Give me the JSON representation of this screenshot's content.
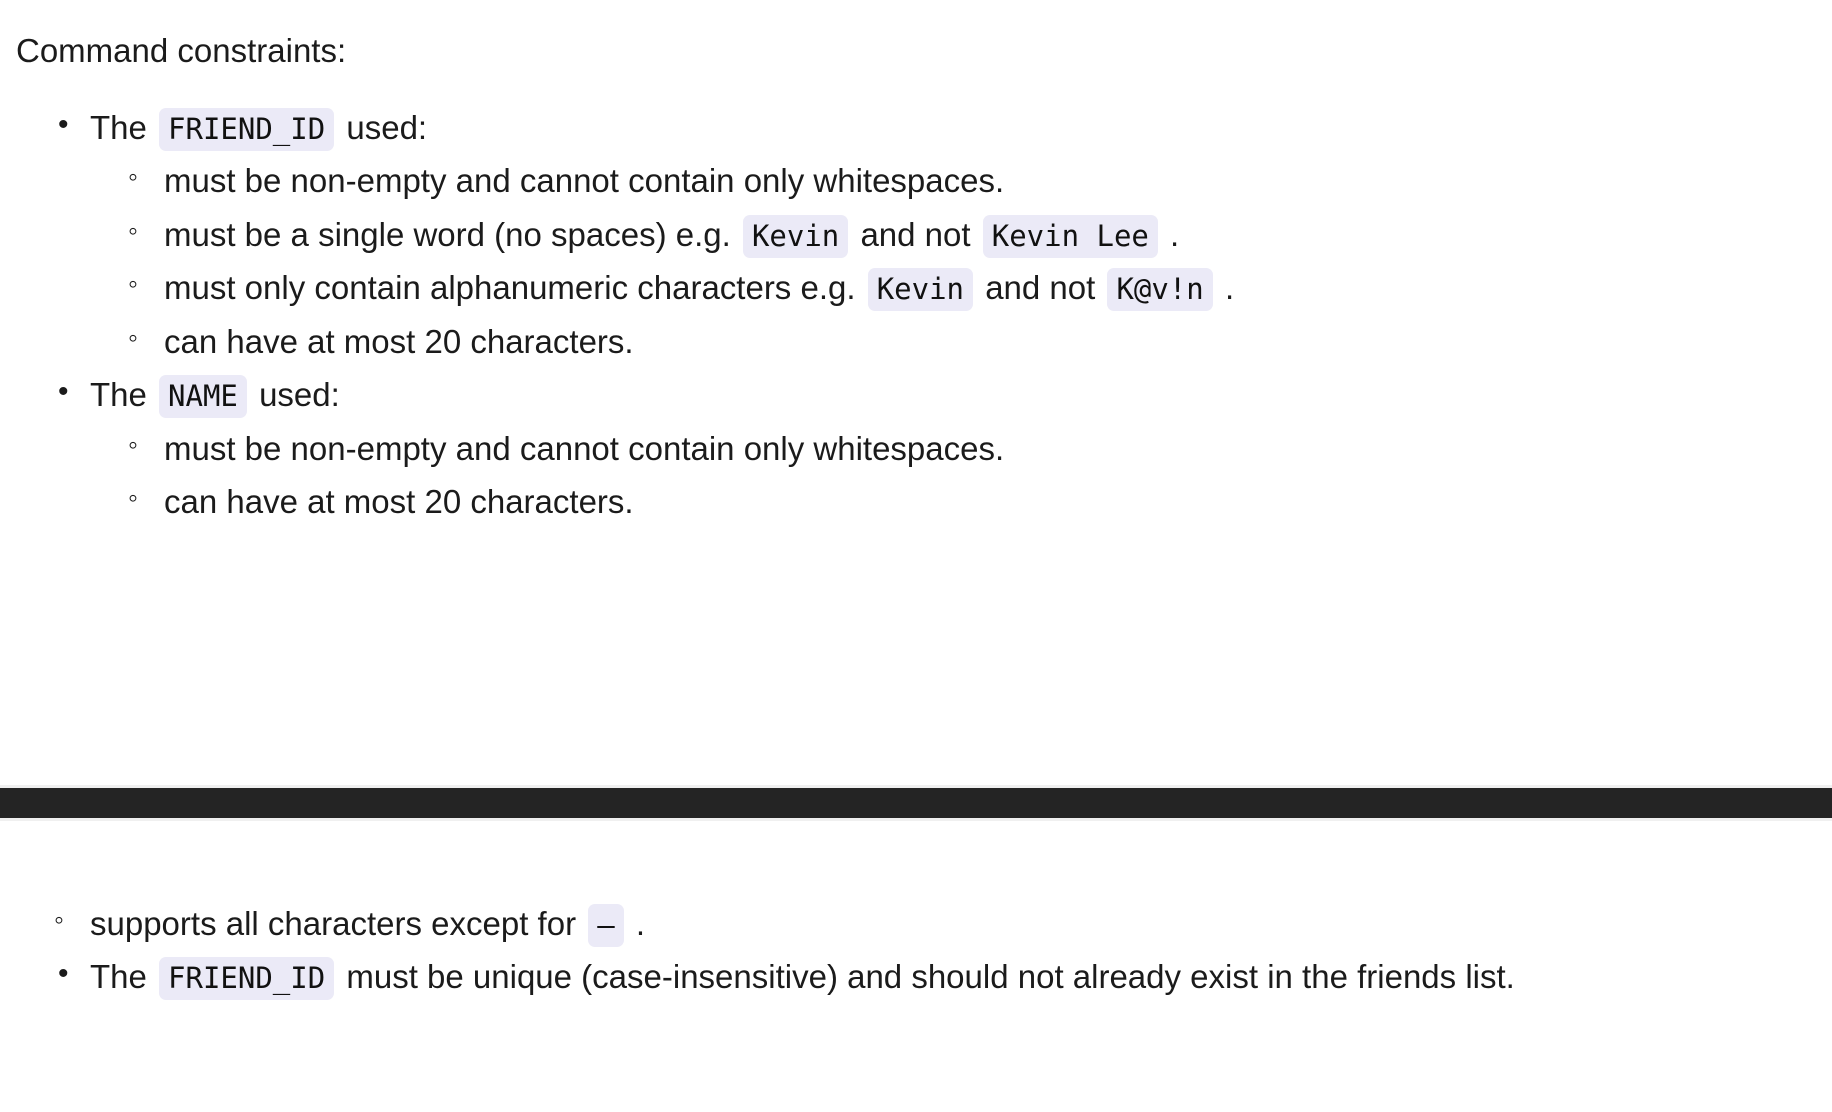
{
  "document": {
    "intro": "Command constraints:",
    "top_section": {
      "items": [
        {
          "lead": "The",
          "code": "FRIEND_ID",
          "tail": "used:",
          "children": [
            {
              "segments": [
                {
                  "type": "text",
                  "value": "must be non-empty and cannot contain only whitespaces."
                }
              ]
            },
            {
              "segments": [
                {
                  "type": "text",
                  "value": "must be a single word (no spaces) e.g."
                },
                {
                  "type": "code",
                  "value": "Kevin"
                },
                {
                  "type": "text",
                  "value": "and not"
                },
                {
                  "type": "code",
                  "value": "Kevin Lee"
                },
                {
                  "type": "text",
                  "value": "."
                }
              ]
            },
            {
              "segments": [
                {
                  "type": "text",
                  "value": "must only contain alphanumeric characters e.g."
                },
                {
                  "type": "code",
                  "value": "Kevin"
                },
                {
                  "type": "text",
                  "value": "and not"
                },
                {
                  "type": "code",
                  "value": "K@v!n"
                },
                {
                  "type": "text",
                  "value": "."
                }
              ]
            },
            {
              "segments": [
                {
                  "type": "text",
                  "value": "can have at most 20 characters."
                }
              ]
            }
          ]
        },
        {
          "lead": "The",
          "code": "NAME",
          "tail": "used:",
          "children": [
            {
              "segments": [
                {
                  "type": "text",
                  "value": "must be non-empty and cannot contain only whitespaces."
                }
              ]
            },
            {
              "segments": [
                {
                  "type": "text",
                  "value": "can have at most 20 characters."
                }
              ]
            }
          ]
        }
      ]
    },
    "bottom_section": {
      "sub_items": [
        {
          "segments": [
            {
              "type": "text",
              "value": "supports all characters except for"
            },
            {
              "type": "code",
              "value": "–"
            },
            {
              "type": "text",
              "value": "."
            }
          ]
        }
      ],
      "items": [
        {
          "lead": "The",
          "code": "FRIEND_ID",
          "tail": "must be unique (case-insensitive) and should not already exist in the friends list."
        }
      ]
    }
  },
  "labels": {
    "line1_text_a": "must be non-empty and cannot contain only whitespaces.",
    "line2_text_a": "must be a single word (no spaces) e.g.",
    "line2_text_b": "and not",
    "line2_text_c": ".",
    "line3_text_a": "must only contain alphanumeric characters e.g.",
    "line3_text_b": "and not",
    "line3_text_c": ".",
    "line4_text_a": "can have at most 20 characters.",
    "name_line1": "must be non-empty and cannot contain only whitespaces.",
    "name_line2": "can have at most 20 characters.",
    "bottom_sub_a": "supports all characters except for",
    "bottom_sub_b": ".",
    "the": "The",
    "used": "used:"
  },
  "codes": {
    "friend_id": "FRIEND_ID",
    "name": "NAME",
    "kevin": "Kevin",
    "kevin_lee": "Kevin Lee",
    "kavin": "K@v!n",
    "dash": "–"
  },
  "colors": {
    "background": "#ffffff",
    "text": "#1b1b1b",
    "code_background": "#ebeaf7",
    "divider_bar": "#242424",
    "divider_edge": "#f0f0f0"
  }
}
